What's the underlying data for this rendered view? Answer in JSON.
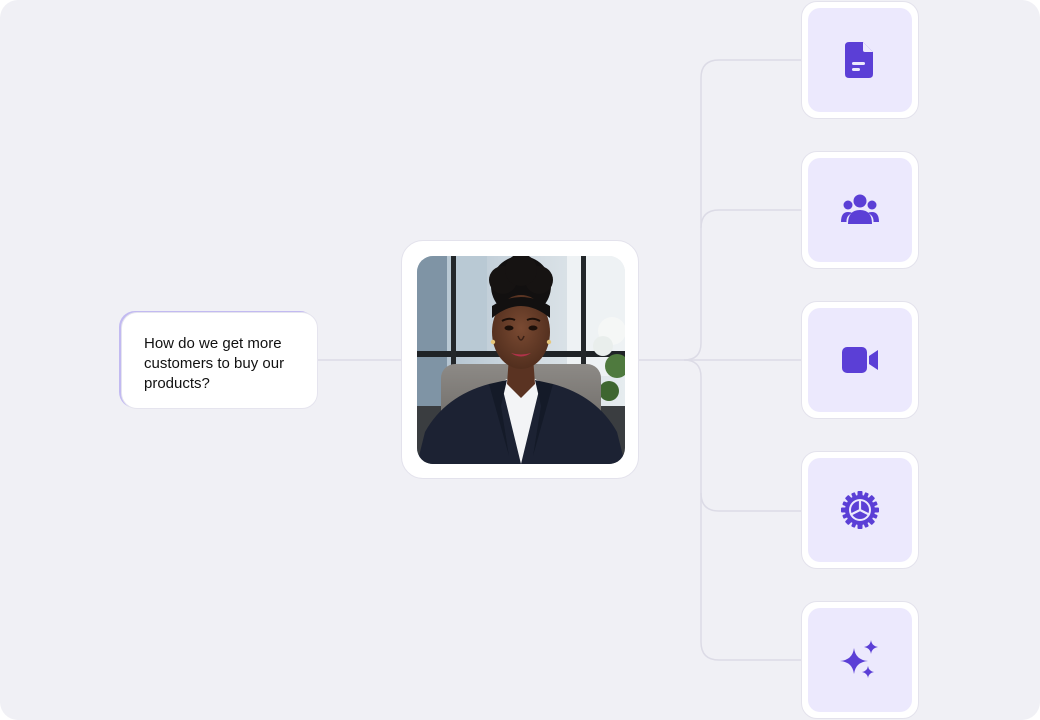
{
  "question": {
    "text": "How do we get more customers to buy our products?"
  },
  "avatar": {
    "description_icon": "presenter-avatar"
  },
  "outputs": [
    {
      "icon": "document-icon"
    },
    {
      "icon": "team-icon"
    },
    {
      "icon": "video-camera-icon"
    },
    {
      "icon": "settings-gear-icon"
    },
    {
      "icon": "sparkles-icon"
    }
  ],
  "colors": {
    "background": "#f0f0f5",
    "accent": "#5b3fd6",
    "icon_tile": "#ece9fd",
    "connector": "#dcdbe6"
  }
}
